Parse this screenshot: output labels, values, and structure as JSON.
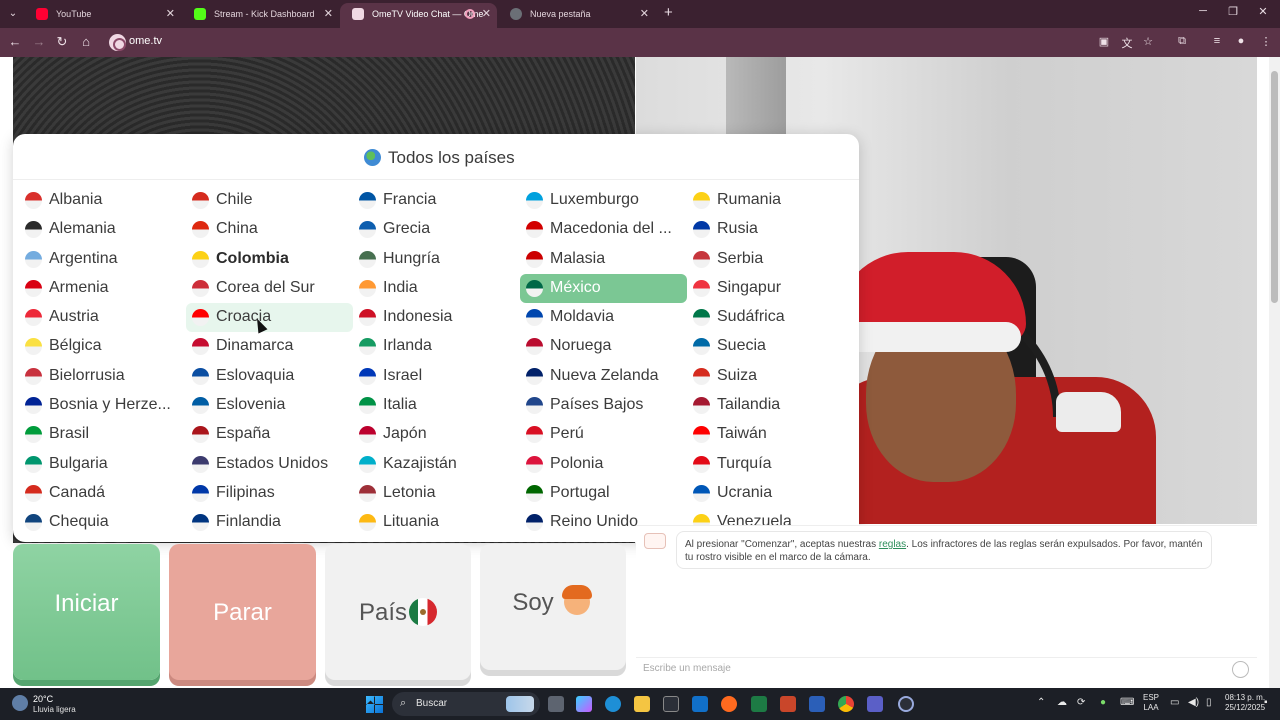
{
  "browser": {
    "tabs": [
      {
        "title": "YouTube",
        "color": "#ff0033"
      },
      {
        "title": "Stream - Kick Dashboard",
        "color": "#53fc18"
      },
      {
        "title": "OmeTV Video Chat — Ome",
        "color": "#f0d8e3"
      },
      {
        "title": "Nueva pestaña",
        "color": "#6b6f76"
      }
    ],
    "url": "ome.tv"
  },
  "country_picker": {
    "title": "Todos los países",
    "columns": [
      [
        "Albania",
        "Alemania",
        "Argentina",
        "Armenia",
        "Austria",
        "Bélgica",
        "Bielorrusia",
        "Bosnia y Herze...",
        "Brasil",
        "Bulgaria",
        "Canadá",
        "Chequia"
      ],
      [
        "Chile",
        "China",
        "Colombia",
        "Corea del Sur",
        "Croacia",
        "Dinamarca",
        "Eslovaquia",
        "Eslovenia",
        "España",
        "Estados Unidos",
        "Filipinas",
        "Finlandia"
      ],
      [
        "Francia",
        "Grecia",
        "Hungría",
        "India",
        "Indonesia",
        "Irlanda",
        "Israel",
        "Italia",
        "Japón",
        "Kazajistán",
        "Letonia",
        "Lituania"
      ],
      [
        "Luxemburgo",
        "Macedonia del ...",
        "Malasia",
        "México",
        "Moldavia",
        "Noruega",
        "Nueva Zelanda",
        "Países Bajos",
        "Perú",
        "Polonia",
        "Portugal",
        "Reino Unido"
      ],
      [
        "Rumania",
        "Rusia",
        "Serbia",
        "Singapur",
        "Sudáfrica",
        "Suecia",
        "Suiza",
        "Tailandia",
        "Taiwán",
        "Turquía",
        "Ucrania",
        "Venezuela"
      ]
    ],
    "selected": "México",
    "hovered": "Croacia",
    "bold": "Colombia"
  },
  "controls": {
    "start": "Iniciar",
    "stop": "Parar",
    "country": "País",
    "gender": "Soy"
  },
  "chat": {
    "notice_pre": "Al presionar \"Comenzar\", aceptas nuestras ",
    "notice_link": "reglas",
    "notice_post": ". Los infractores de las reglas serán expulsados. Por favor, mantén tu rostro visible en el marco de la cámara.",
    "input_placeholder": "Escribe un mensaje"
  },
  "taskbar": {
    "weather_temp": "20°C",
    "weather_desc": "Lluvia ligera",
    "search": "Buscar",
    "lang_line1": "ESP",
    "lang_line2": "LAA",
    "time": "08:13 p. m.",
    "date": "25/12/2025"
  },
  "colors": {
    "accent": "#7bc794",
    "start_button": "#71c189",
    "stop_button": "#e8a69b",
    "browser_frame": "#5a3347"
  }
}
